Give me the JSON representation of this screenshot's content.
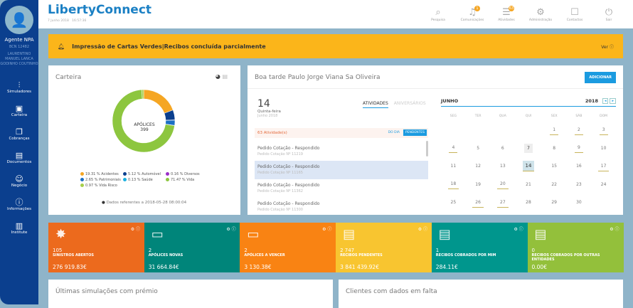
{
  "sidebar": {
    "agent_name": "Agente NPA",
    "agent_code": "BCN 12482",
    "agent_full": "LAURENTINO MANUEL LANCA GODINHO COUTINHO",
    "items": [
      {
        "label": "Simuladores",
        "icon": "sliders-icon",
        "g": "⫶"
      },
      {
        "label": "Carteira",
        "icon": "wallet-icon",
        "g": "▣"
      },
      {
        "label": "Cobranças",
        "icon": "collections-icon",
        "g": "❐"
      },
      {
        "label": "Documentos",
        "icon": "document-icon",
        "g": "▤"
      },
      {
        "label": "Negócio",
        "icon": "business-icon",
        "g": "☺"
      },
      {
        "label": "Informações",
        "icon": "info-icon",
        "g": "ⓘ"
      },
      {
        "label": "Institute",
        "icon": "book-icon",
        "g": "▥"
      }
    ]
  },
  "header": {
    "logo": "LibertyConnect",
    "date": "7 Junho 2018",
    "time": "16:57:36",
    "icons": [
      {
        "label": "Pesquisa",
        "g": "⌕",
        "badge": ""
      },
      {
        "label": "Comunicações",
        "g": "♫",
        "badge": "1"
      },
      {
        "label": "Atividades",
        "g": "☰",
        "badge": "63"
      },
      {
        "label": "Administração",
        "g": "⚙",
        "badge": ""
      },
      {
        "label": "Contactos",
        "g": "☐",
        "badge": ""
      },
      {
        "label": "Sair",
        "g": "⏻",
        "badge": ""
      }
    ]
  },
  "banner": {
    "text": "Impressão de Cartas Verdes|Recibos concluída parcialmente",
    "link": "Ver"
  },
  "carteira": {
    "title": "Carteira",
    "center_label": "APÓLICES",
    "center_value": "399",
    "ref": "Dados referentes a 2018-05-28 08:00:04",
    "chart_data": {
      "type": "pie",
      "slices": [
        {
          "name": "Acidentes",
          "value": 19.31,
          "color": "#f5a623",
          "label": "19.31 % Acidentes"
        },
        {
          "name": "Automóvel",
          "value": 5.12,
          "color": "#0b3f8e",
          "label": "5.12 % Automóvel"
        },
        {
          "name": "Diversos",
          "value": 0.16,
          "color": "#9b2fc9",
          "label": "0.16 % Diversos"
        },
        {
          "name": "Patrimoniais",
          "value": 2.65,
          "color": "#1b6fc4",
          "label": "2.65 % Patrimoniais"
        },
        {
          "name": "Saúde",
          "value": 0.13,
          "color": "#1bb0e0",
          "label": "0.13 % Saúde"
        },
        {
          "name": "Vida",
          "value": 71.47,
          "color": "#8dc63f",
          "label": "71.47 % Vida"
        },
        {
          "name": "Vida Risco",
          "value": 0.97,
          "color": "#a6cf4a",
          "label": "0.97 % Vida Risco"
        }
      ]
    }
  },
  "greeting": {
    "title": "Boa tarde Paulo Jorge Viana Sa Oliveira",
    "add": "ADICIONAR",
    "day": "14",
    "weekday": "Quinta-feira",
    "month_year": "Junho 2018",
    "tabs": [
      "ATIVIDADES",
      "ANIVERSÁRIOS"
    ],
    "count": "63 Atividade(s)",
    "filter_day": "DO DIA",
    "filter_pending": "PENDENTES",
    "items": [
      {
        "t": "Pedido Cotação - Respondido",
        "s": "Pedido Cotação Nº 11219"
      },
      {
        "t": "Pedido Cotação - Respondido",
        "s": "Pedido Cotação Nº 11165"
      },
      {
        "t": "Pedido Cotação - Respondido",
        "s": "Pedido Cotação Nº 11362"
      },
      {
        "t": "Pedido Cotação - Respondido",
        "s": "Pedido Cotação Nº 11300"
      }
    ]
  },
  "calendar": {
    "month": "JUNHO",
    "year": "2018",
    "weekdays": [
      "SEG",
      "TER",
      "QUA",
      "QUI",
      "SEX",
      "SÁB",
      "DOM"
    ],
    "weeks": [
      [
        "",
        "",
        "",
        "",
        "1",
        "2",
        "3"
      ],
      [
        "4",
        "5",
        "6",
        "7",
        "8",
        "9",
        "10"
      ],
      [
        "11",
        "12",
        "13",
        "14",
        "15",
        "16",
        "17"
      ],
      [
        "18",
        "19",
        "20",
        "21",
        "22",
        "23",
        "24"
      ],
      [
        "25",
        "26",
        "27",
        "28",
        "29",
        "30",
        ""
      ]
    ],
    "marked": [
      "1",
      "2",
      "3",
      "4",
      "9",
      "14",
      "17",
      "18",
      "20",
      "26",
      "27"
    ],
    "today": "14",
    "selected": "7"
  },
  "tiles": [
    {
      "n": "105",
      "l": "SINISTROS ABERTOS",
      "v": "276 919.83€",
      "color": "#ec6a1d",
      "g": "✸"
    },
    {
      "n": "2",
      "l": "APÓLICES NOVAS",
      "v": "31 664.84€",
      "color": "#00857a",
      "g": "▭"
    },
    {
      "n": "2",
      "l": "APÓLICES A VENCER",
      "v": "3 130.38€",
      "color": "#f98313",
      "g": "▭"
    },
    {
      "n": "2 747",
      "l": "RECIBOS PENDENTES",
      "v": "3 841 439.92€",
      "color": "#f8c530",
      "g": "▤"
    },
    {
      "n": "1",
      "l": "RECIBOS COBRADOS POR MIM",
      "v": "284.11€",
      "color": "#00968d",
      "g": "▤"
    },
    {
      "n": "0",
      "l": "RECIBOS COBRADOS POR OUTRAS ENTIDADES",
      "v": "0.00€",
      "color": "#93c03b",
      "g": "▤"
    }
  ],
  "bottom": {
    "left": "Últimas simulações com prémio",
    "right": "Clientes com dados em falta"
  }
}
